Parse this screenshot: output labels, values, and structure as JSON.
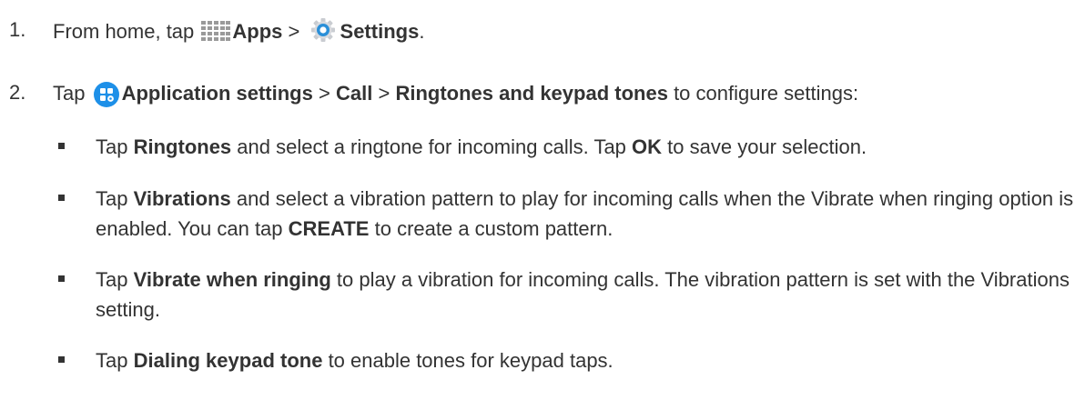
{
  "steps": [
    {
      "number": "1.",
      "t1": "From home, tap",
      "icon1": "apps-grid-icon",
      "b1": "Apps",
      "t2": ">",
      "icon2": "settings-gear-icon",
      "b2": "Settings",
      "t3": "."
    },
    {
      "number": "2.",
      "t1": "Tap",
      "icon1": "application-settings-icon",
      "b1": "Application settings",
      "t2": ">",
      "b2": "Call",
      "t3": ">",
      "b3": "Ringtones and keypad tones",
      "t4": "to configure settings:"
    }
  ],
  "bullets": [
    {
      "t1": "Tap",
      "b1": "Ringtones",
      "t2": "and select a ringtone for incoming calls. Tap",
      "b2": "OK",
      "t3": "to save your selection."
    },
    {
      "t1": "Tap",
      "b1": "Vibrations",
      "t2": "and select a vibration pattern to play for incoming calls when the Vibrate when ringing option is enabled. You can tap",
      "b2": "CREATE",
      "t3": "to create a custom pattern."
    },
    {
      "t1": "Tap",
      "b1": "Vibrate when ringing",
      "t2": "to play a vibration for incoming calls. The vibration pattern is set with the Vibrations setting."
    },
    {
      "t1": "Tap",
      "b1": "Dialing keypad tone",
      "t2": "to enable tones for keypad taps."
    }
  ],
  "colors": {
    "text": "#333333",
    "apps_icon": "#9a9a9a",
    "settings_icon": "#2a8fd8",
    "app_settings_icon": "#1e90e8"
  }
}
